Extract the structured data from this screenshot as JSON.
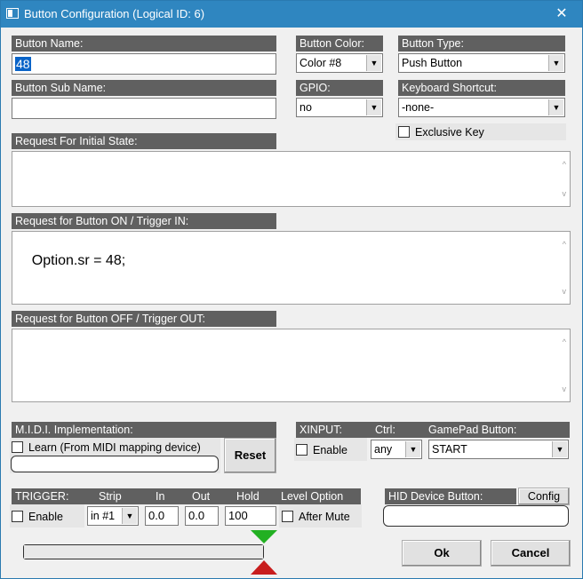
{
  "window": {
    "title": "Button Configuration (Logical ID: 6)",
    "close_glyph": "✕",
    "accent": "#2f86c0"
  },
  "button_name": {
    "label": "Button Name:",
    "value": "48"
  },
  "button_color": {
    "label": "Button Color:",
    "value": "Color #8"
  },
  "button_type": {
    "label": "Button Type:",
    "value": "Push Button"
  },
  "button_sub_name": {
    "label": "Button Sub Name:",
    "value": ""
  },
  "gpio": {
    "label": "GPIO:",
    "value": "no"
  },
  "keyboard_shortcut": {
    "label": "Keyboard Shortcut:",
    "value": "-none-"
  },
  "exclusive_key": {
    "label": "Exclusive Key",
    "checked": false
  },
  "initial_state": {
    "label": "Request For Initial State:",
    "value": ""
  },
  "button_on": {
    "label": "Request for Button ON / Trigger IN:",
    "value": "Option.sr = 48;"
  },
  "button_off": {
    "label": "Request for Button OFF / Trigger OUT:",
    "value": ""
  },
  "midi": {
    "label": "M.I.D.I. Implementation:",
    "learn_label": "Learn (From MIDI mapping device)",
    "learn_checked": false,
    "reset_label": "Reset"
  },
  "xinput": {
    "label": "XINPUT:",
    "ctrl_label": "Ctrl:",
    "gamepad_label": "GamePad Button:",
    "enable_label": "Enable",
    "enable_checked": false,
    "ctrl_value": "any",
    "gamepad_value": "START"
  },
  "trigger": {
    "label": "TRIGGER:",
    "strip_label": "Strip",
    "in_label": "In",
    "out_label": "Out",
    "hold_label": "Hold",
    "level_option_label": "Level Option",
    "enable_label": "Enable",
    "enable_checked": false,
    "strip_value": "in #1",
    "in_value": "0.0",
    "out_value": "0.0",
    "hold_value": "100",
    "after_mute_label": "After Mute",
    "after_mute_checked": false,
    "level_fraction": 1.0,
    "in_marker_color": "#22b022",
    "out_marker_color": "#c81e1e"
  },
  "hid": {
    "label": "HID Device Button:",
    "config_label": "Config",
    "value": ""
  },
  "ok_label": "Ok",
  "cancel_label": "Cancel",
  "icons": {
    "dropdown": "▼",
    "scroll_up": "^",
    "scroll_down": "v"
  }
}
